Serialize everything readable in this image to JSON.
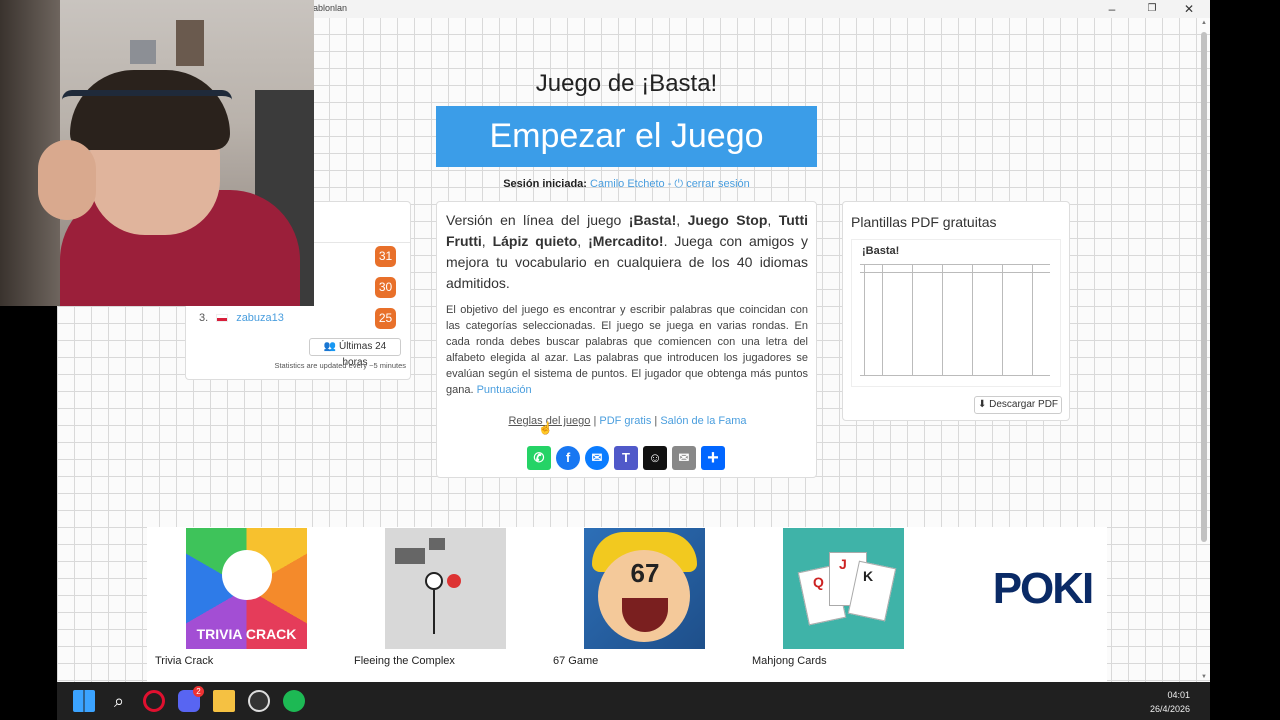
{
  "window": {
    "title_fragment": "ablonlan",
    "controls": {
      "minimize": "–",
      "maximize": "❐",
      "close": "✕"
    }
  },
  "page": {
    "title": "Juego de ¡Basta!",
    "start_button": "Empezar el Juego",
    "session": {
      "label": "Sesión iniciada:",
      "user": "Camilo Etcheto",
      "separator": "-",
      "logout": "cerrar sesión"
    }
  },
  "leaderboard": {
    "scores": [
      "31",
      "30",
      "25"
    ],
    "row3_rank": "3.",
    "row3_user": "zabuza13",
    "last24_button": "Últimas 24 horas",
    "stats_note": "Statistics are updated every ~5 minutes"
  },
  "info": {
    "intro_start": "Versión en línea del juego ",
    "game1": "¡Basta!",
    "game2": "Juego Stop",
    "game3": "Tutti Frutti",
    "game4": "Lápiz quieto",
    "game5": "¡Mercadito!",
    "intro_end": ". Juega con amigos y mejora tu vocabulario en cualquiera de los 40 idiomas admitidos.",
    "description": "El objetivo del juego es encontrar y escribir palabras que coincidan con las categorías seleccionadas. El juego se juega en varias rondas. En cada ronda debes buscar palabras que comiencen con una letra del alfabeto elegida al azar. Las palabras que introducen los jugadores se evalúan según el sistema de puntos. El jugador que obtenga más puntos gana.",
    "scoring_link": "Puntuación",
    "links": {
      "rules": "Reglas del juego",
      "pdf": "PDF gratis",
      "fame": "Salón de la Fama",
      "sep": "|"
    },
    "share": [
      {
        "name": "whatsapp",
        "color": "#25d366",
        "glyph": "✆"
      },
      {
        "name": "facebook",
        "color": "#1877f2",
        "glyph": "f"
      },
      {
        "name": "messenger",
        "color": "#0a7cff",
        "glyph": "✉"
      },
      {
        "name": "teams",
        "color": "#5059c9",
        "glyph": "T"
      },
      {
        "name": "snapchat",
        "color": "#111111",
        "glyph": "☺"
      },
      {
        "name": "email",
        "color": "#888888",
        "glyph": "✉"
      },
      {
        "name": "share",
        "color": "#0166ff",
        "glyph": "+"
      }
    ]
  },
  "pdf": {
    "title": "Plantillas PDF gratuitas",
    "preview_title": "¡Basta!",
    "download": "Descargar PDF"
  },
  "games": [
    {
      "label": "Trivia Crack",
      "thumb_text": "TRIVIA CRACK"
    },
    {
      "label": "Fleeing the Complex",
      "thumb_text": ""
    },
    {
      "label": "67 Game",
      "thumb_text": "67"
    },
    {
      "label": "Mahjong Cards",
      "thumb_text": ""
    },
    {
      "label": "",
      "thumb_text": "POKI"
    }
  ],
  "taskbar": {
    "time": "04:01",
    "date": "26/4/2026",
    "discord_badge": "2",
    "icons": [
      "windows-icon",
      "search-icon",
      "opera-icon",
      "discord-icon",
      "files-icon",
      "obs-icon",
      "spotify-icon"
    ]
  }
}
